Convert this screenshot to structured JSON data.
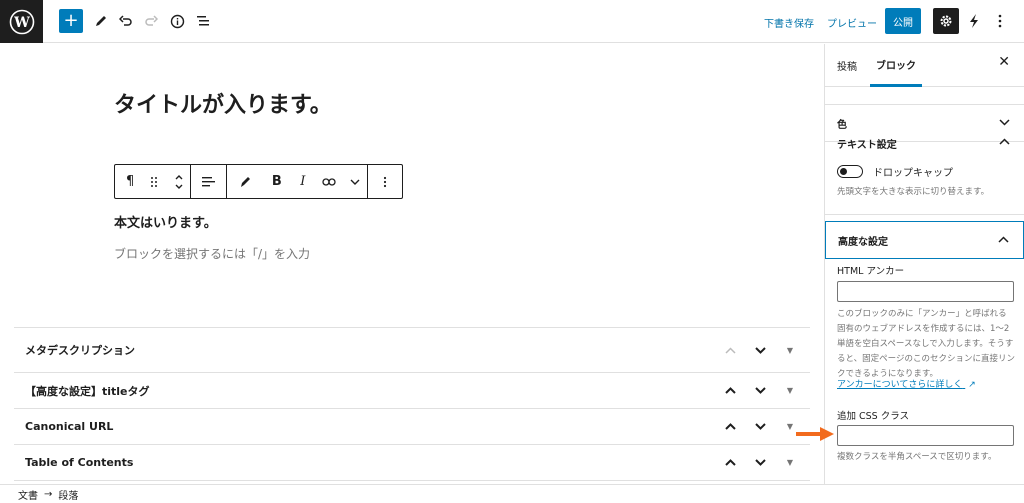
{
  "toolbar": {
    "save_draft": "下書き保存",
    "preview": "プレビュー",
    "publish": "公開"
  },
  "editor": {
    "title": "タイトルが入ります。",
    "paragraph": "本文はいります。",
    "placeholder": "ブロックを選択するには「/」を入力",
    "block_toolbar": {
      "bold": "B",
      "italic": "I"
    }
  },
  "metaboxes": [
    {
      "label": "メタデスクリプション"
    },
    {
      "label": "【高度な設定】titleタグ"
    },
    {
      "label": "Canonical URL"
    },
    {
      "label": "Table of Contents"
    }
  ],
  "footer": {
    "crumb_root": "文書",
    "crumb_arrow": "→",
    "crumb_current": "段落"
  },
  "sidebar": {
    "tabs": [
      {
        "label": "投稿"
      },
      {
        "label": "ブロック"
      }
    ],
    "panels": {
      "color": "色",
      "text_settings": "テキスト設定",
      "dropcap_label": "ドロップキャップ",
      "dropcap_help": "先頭文字を大きな表示に切り替えます。",
      "advanced": "高度な設定",
      "html_anchor_label": "HTML アンカー",
      "html_anchor_value": "",
      "anchor_help": "このブロックのみに「アンカー」と呼ばれる固有のウェブアドレスを作成するには、1〜2 単語を空白スペースなしで入力します。そうすると、固定ページのこのセクションに直接リンクできるようになります。",
      "anchor_link": "アンカーについてさらに詳しく",
      "css_class_label": "追加 CSS クラス",
      "css_class_value": "",
      "css_class_help": "複数クラスを半角スペースで区切ります。"
    }
  },
  "colors": {
    "accent": "#007cba",
    "arrow": "#f26b1d"
  }
}
